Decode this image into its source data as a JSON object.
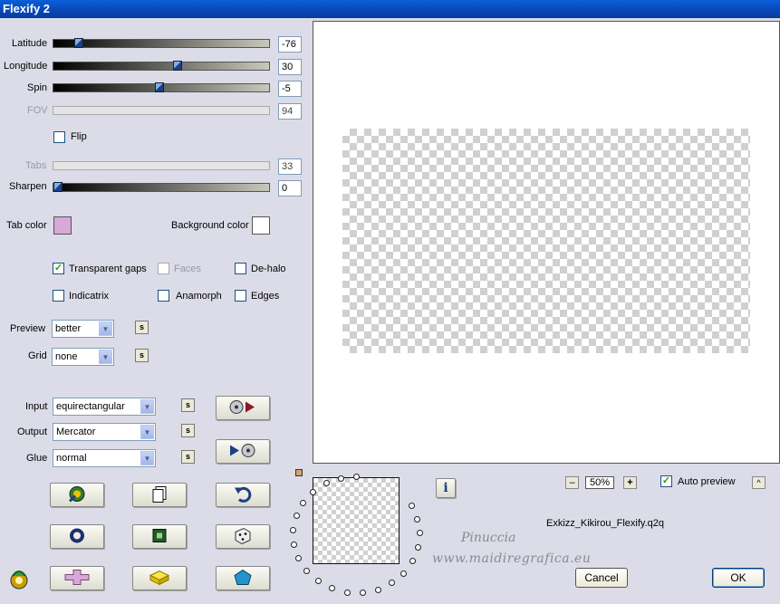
{
  "window": {
    "title": "Flexify 2"
  },
  "sliders": {
    "latitude": {
      "label": "Latitude",
      "value": "-76",
      "level": 0.1
    },
    "longitude": {
      "label": "Longitude",
      "value": "30",
      "level": 0.58
    },
    "spin": {
      "label": "Spin",
      "value": "-5",
      "level": 0.49
    },
    "fov": {
      "label": "FOV",
      "value": "94",
      "enabled": false
    },
    "tabs": {
      "label": "Tabs",
      "value": "33",
      "enabled": false
    },
    "sharpen": {
      "label": "Sharpen",
      "value": "0",
      "level": 0.0
    }
  },
  "flip": {
    "label": "Flip",
    "checked": false
  },
  "colors": {
    "tab_color_label": "Tab color",
    "tab_color": "#d8a8d8",
    "background_color_label": "Background color",
    "background_color": "#ffffff"
  },
  "options": {
    "transparent_gaps": {
      "label": "Transparent gaps",
      "checked": true
    },
    "faces": {
      "label": "Faces",
      "checked": false,
      "enabled": false
    },
    "de_halo": {
      "label": "De-halo",
      "checked": false
    },
    "indicatrix": {
      "label": "Indicatrix",
      "checked": false
    },
    "anamorph": {
      "label": "Anamorph",
      "checked": false
    },
    "edges": {
      "label": "Edges",
      "checked": false
    }
  },
  "preview_select": {
    "label": "Preview",
    "value": "better"
  },
  "grid_select": {
    "label": "Grid",
    "value": "none"
  },
  "input_select": {
    "label": "Input",
    "value": "equirectangular"
  },
  "output_select": {
    "label": "Output",
    "value": "Mercator"
  },
  "glue_select": {
    "label": "Glue",
    "value": "normal"
  },
  "small_button_label": "s",
  "zoom": {
    "minus": "–",
    "value": "50%",
    "plus": "+"
  },
  "auto_preview": {
    "label": "Auto preview",
    "checked": true
  },
  "scroll_up": "^",
  "info_button": "i",
  "preset_file": "Exkizz_Kikirou_Flexify.q2q",
  "watermark": {
    "line1": "Pinuccia",
    "line2": "www.maidiregrafica.eu"
  },
  "buttons": {
    "cancel": "Cancel",
    "ok": "OK"
  },
  "icons": [
    "randomize-icon",
    "load-preset-icon",
    "undo-icon",
    "ring-icon",
    "square-frame-icon",
    "dice-icon",
    "plus-shape-icon",
    "brick-icon",
    "pentagon-icon",
    "to-input-icon",
    "to-output-icon",
    "flexify-logo-icon"
  ]
}
